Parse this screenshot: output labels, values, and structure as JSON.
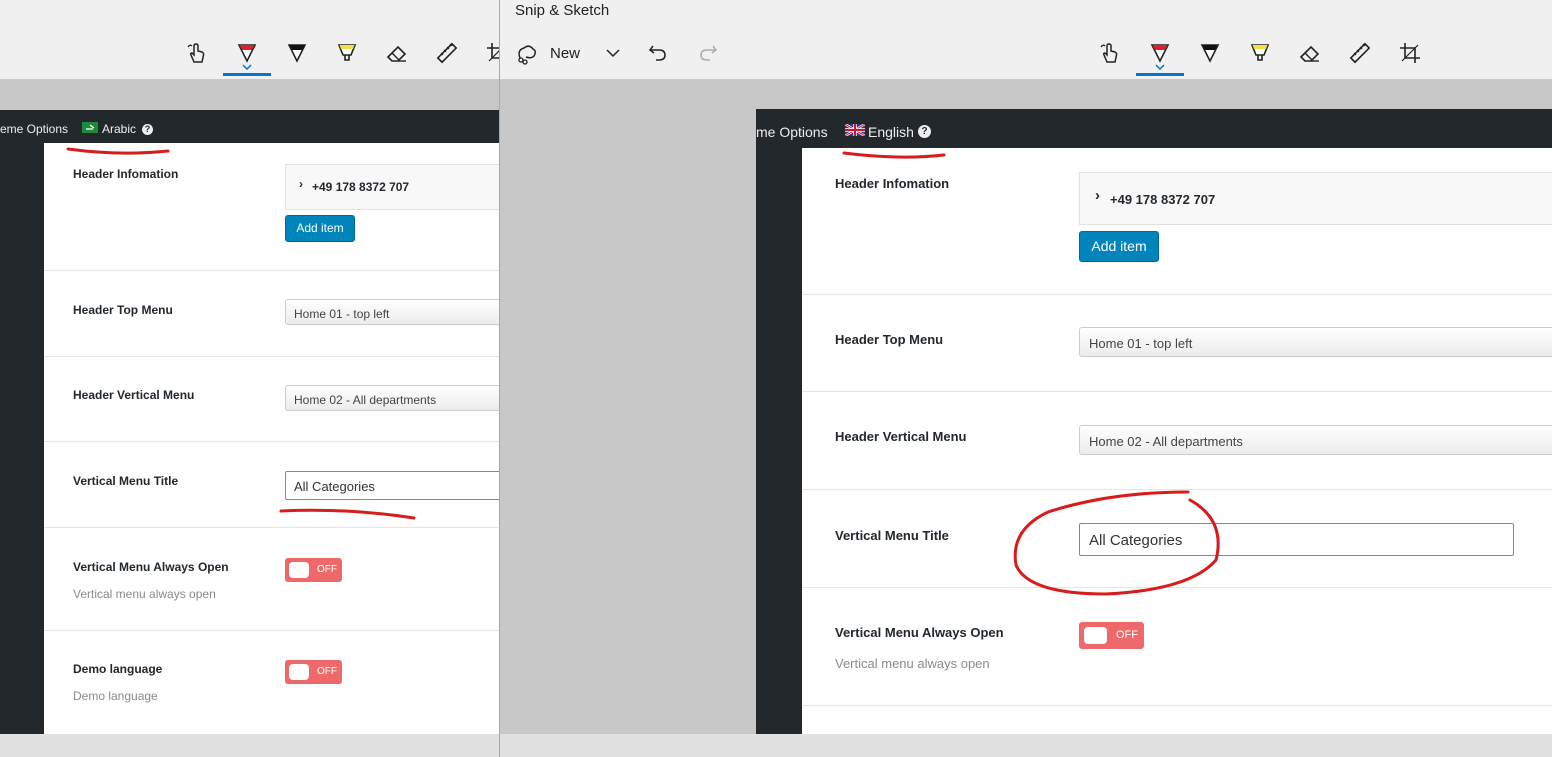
{
  "left_window": {
    "admin_bar": {
      "theme_options": "eme Options",
      "language": "Arabic",
      "help": "?"
    },
    "rows": {
      "header_information": {
        "label": "Header Infomation",
        "item": "+49 178 8372 707",
        "add_item": "Add item"
      },
      "header_top_menu": {
        "label": "Header Top Menu",
        "value": "Home 01 - top left"
      },
      "header_vertical_menu": {
        "label": "Header Vertical Menu",
        "value": "Home 02 - All departments"
      },
      "vertical_menu_title": {
        "label": "Vertical Menu Title",
        "value": "All Categories"
      },
      "vertical_menu_always_open": {
        "label": "Vertical Menu Always Open",
        "description": "Vertical menu always open",
        "state": "OFF"
      },
      "demo_language": {
        "label": "Demo language",
        "description": "Demo language",
        "state": "OFF"
      }
    }
  },
  "right_window": {
    "title": "Snip & Sketch",
    "toolbar": {
      "new_label": "New"
    },
    "admin_bar": {
      "theme_options": "me Options",
      "language": "English",
      "help": "?"
    },
    "rows": {
      "header_information": {
        "label": "Header Infomation",
        "item": "+49 178 8372 707",
        "add_item": "Add item"
      },
      "header_top_menu": {
        "label": "Header Top Menu",
        "value": "Home 01 - top left"
      },
      "header_vertical_menu": {
        "label": "Header Vertical Menu",
        "value": "Home 02 - All departments"
      },
      "vertical_menu_title": {
        "label": "Vertical Menu Title",
        "value": "All Categories"
      },
      "vertical_menu_always_open": {
        "label": "Vertical Menu Always Open",
        "description": "Vertical menu always open",
        "state": "OFF"
      }
    }
  },
  "colors": {
    "accent": "#0078d4",
    "admin_bar": "#23282d",
    "button_blue": "#0085ba",
    "toggle_off": "#ee6a6a",
    "annotation_red": "#d81b1b",
    "highlighter_yellow": "#f6e04a"
  },
  "icons": [
    "touch-writing-icon",
    "ballpoint-pen-icon",
    "pencil-icon",
    "highlighter-icon",
    "eraser-icon",
    "ruler-icon",
    "crop-icon",
    "new-snip-icon",
    "chevron-down-icon",
    "undo-icon",
    "redo-icon",
    "chevron-right-icon",
    "help-icon",
    "flag-icon"
  ]
}
